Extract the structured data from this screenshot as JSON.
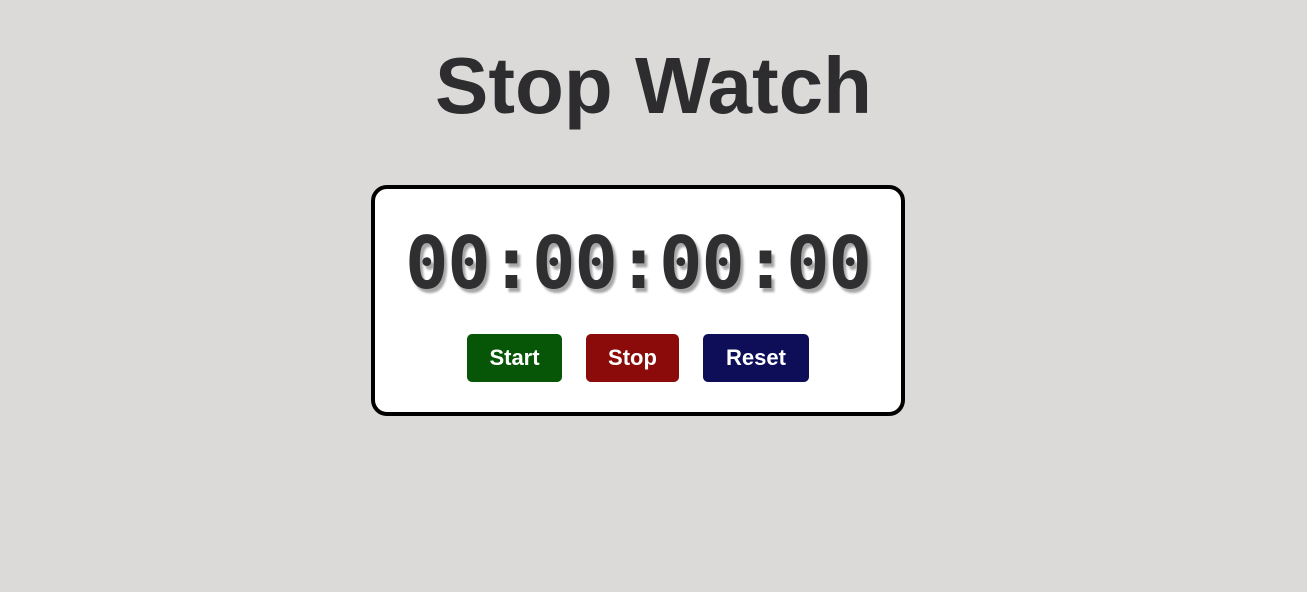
{
  "page": {
    "title": "Stop Watch",
    "background": "#dcd9d9"
  },
  "stopwatch": {
    "display": "00:00:00:00"
  },
  "controls": {
    "start": {
      "label": "Start",
      "color": "#075608"
    },
    "stop": {
      "label": "Stop",
      "color": "#8b0b0b"
    },
    "reset": {
      "label": "Reset",
      "color": "#0d0d58"
    }
  }
}
